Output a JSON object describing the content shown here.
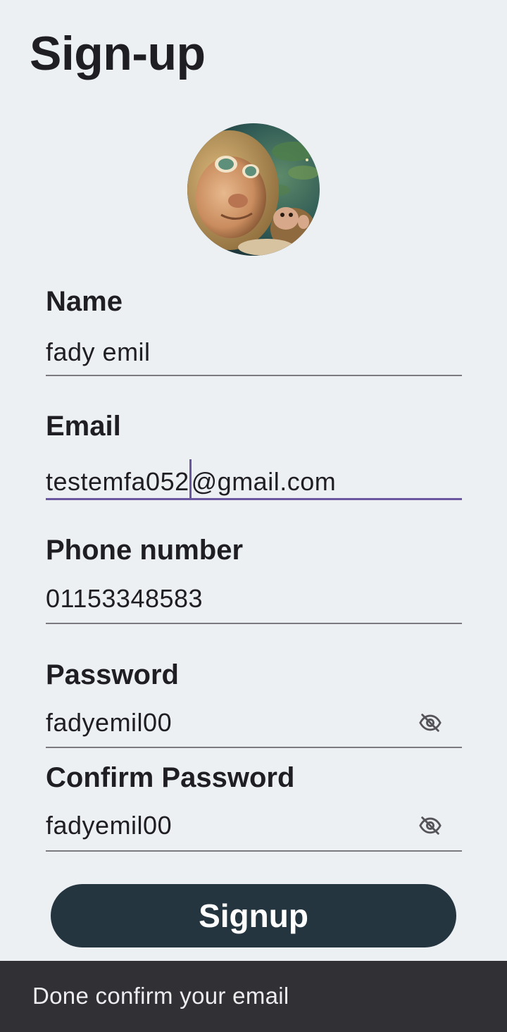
{
  "page": {
    "title": "Sign-up"
  },
  "form": {
    "name": {
      "label": "Name",
      "value": "fady emil"
    },
    "email": {
      "label": "Email",
      "value_before_caret": "testemfa052",
      "value_after_caret": "@gmail.com"
    },
    "phone": {
      "label": "Phone number",
      "value": "01153348583"
    },
    "password": {
      "label": "Password",
      "value": "fadyemil00",
      "toggle_icon": "eye-off-icon"
    },
    "confirm_password": {
      "label": "Confirm Password",
      "value": "fadyemil00",
      "toggle_icon": "eye-off-icon"
    }
  },
  "actions": {
    "signup_label": "Signup"
  },
  "snackbar": {
    "message": "Done confirm your email"
  },
  "colors": {
    "background": "#edf0f3",
    "button": "#243540",
    "focus": "#6a57a0",
    "snackbar": "#313035"
  }
}
